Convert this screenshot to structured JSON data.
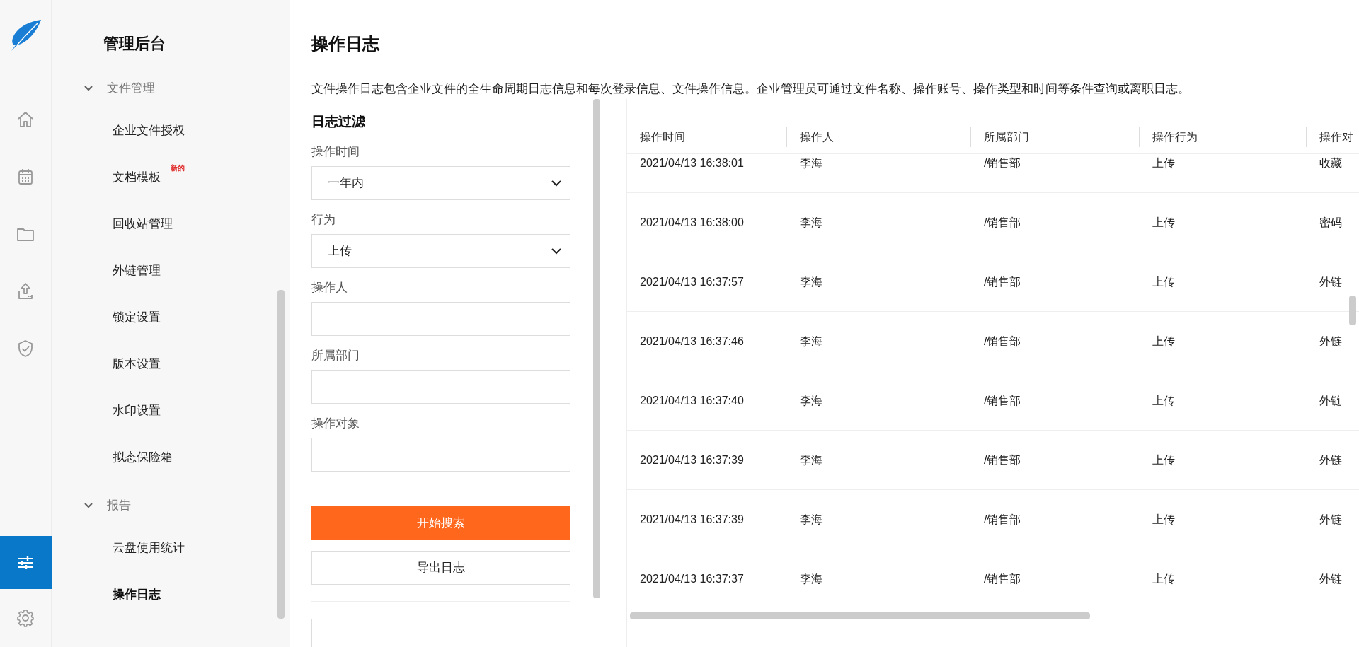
{
  "nav_rail": [
    {
      "kind": "home",
      "selected": false
    },
    {
      "kind": "calendar",
      "selected": false
    },
    {
      "kind": "folder",
      "selected": false
    },
    {
      "kind": "upload",
      "selected": false
    },
    {
      "kind": "shield",
      "selected": false
    },
    {
      "kind": "sliders",
      "selected": true
    },
    {
      "kind": "gear",
      "selected": false
    }
  ],
  "sidebar": {
    "title": "管理后台",
    "groups": [
      {
        "label": "文件管理",
        "expanded": true,
        "children": [
          {
            "label": "企业文件授权",
            "selected": false
          },
          {
            "label": "文档模板",
            "badge": "新的",
            "selected": false
          },
          {
            "label": "回收站管理",
            "selected": false
          },
          {
            "label": "外链管理",
            "selected": false
          },
          {
            "label": "锁定设置",
            "selected": false
          },
          {
            "label": "版本设置",
            "selected": false
          },
          {
            "label": "水印设置",
            "selected": false
          },
          {
            "label": "拟态保险箱",
            "selected": false
          }
        ]
      },
      {
        "label": "报告",
        "expanded": true,
        "children": [
          {
            "label": "云盘使用统计",
            "selected": false
          },
          {
            "label": "操作日志",
            "selected": true
          }
        ]
      }
    ]
  },
  "page": {
    "title": "操作日志",
    "description": "文件操作日志包含企业文件的全生命周期日志信息和每次登录信息、文件操作信息。企业管理员可通过文件名称、操作账号、操作类型和时间等条件查询或离职日志。"
  },
  "filter": {
    "title": "日志过滤",
    "fields": [
      {
        "label": "操作时间",
        "kind": "select",
        "value": "一年内"
      },
      {
        "label": "行为",
        "kind": "select",
        "value": "上传"
      },
      {
        "label": "操作人",
        "kind": "text"
      },
      {
        "label": "所属部门",
        "kind": "text"
      },
      {
        "label": "操作对象",
        "kind": "text"
      }
    ],
    "buttons": [
      {
        "label": "开始搜索",
        "kind": "primary"
      },
      {
        "label": "导出日志",
        "kind": "secondary"
      }
    ]
  },
  "table": {
    "columns": [
      "操作时间",
      "操作人",
      "所属部门",
      "操作行为",
      "操作对"
    ],
    "rows": [
      [
        "2021/04/13 16:38:01",
        "李海",
        "/销售部",
        "上传",
        "收藏"
      ],
      [
        "2021/04/13 16:38:00",
        "李海",
        "/销售部",
        "上传",
        "密码"
      ],
      [
        "2021/04/13 16:37:57",
        "李海",
        "/销售部",
        "上传",
        "外链"
      ],
      [
        "2021/04/13 16:37:46",
        "李海",
        "/销售部",
        "上传",
        "外链"
      ],
      [
        "2021/04/13 16:37:40",
        "李海",
        "/销售部",
        "上传",
        "外链"
      ],
      [
        "2021/04/13 16:37:39",
        "李海",
        "/销售部",
        "上传",
        "外链"
      ],
      [
        "2021/04/13 16:37:39",
        "李海",
        "/销售部",
        "上传",
        "外链"
      ],
      [
        "2021/04/13 16:37:37",
        "李海",
        "/销售部",
        "上传",
        "外链"
      ]
    ]
  }
}
